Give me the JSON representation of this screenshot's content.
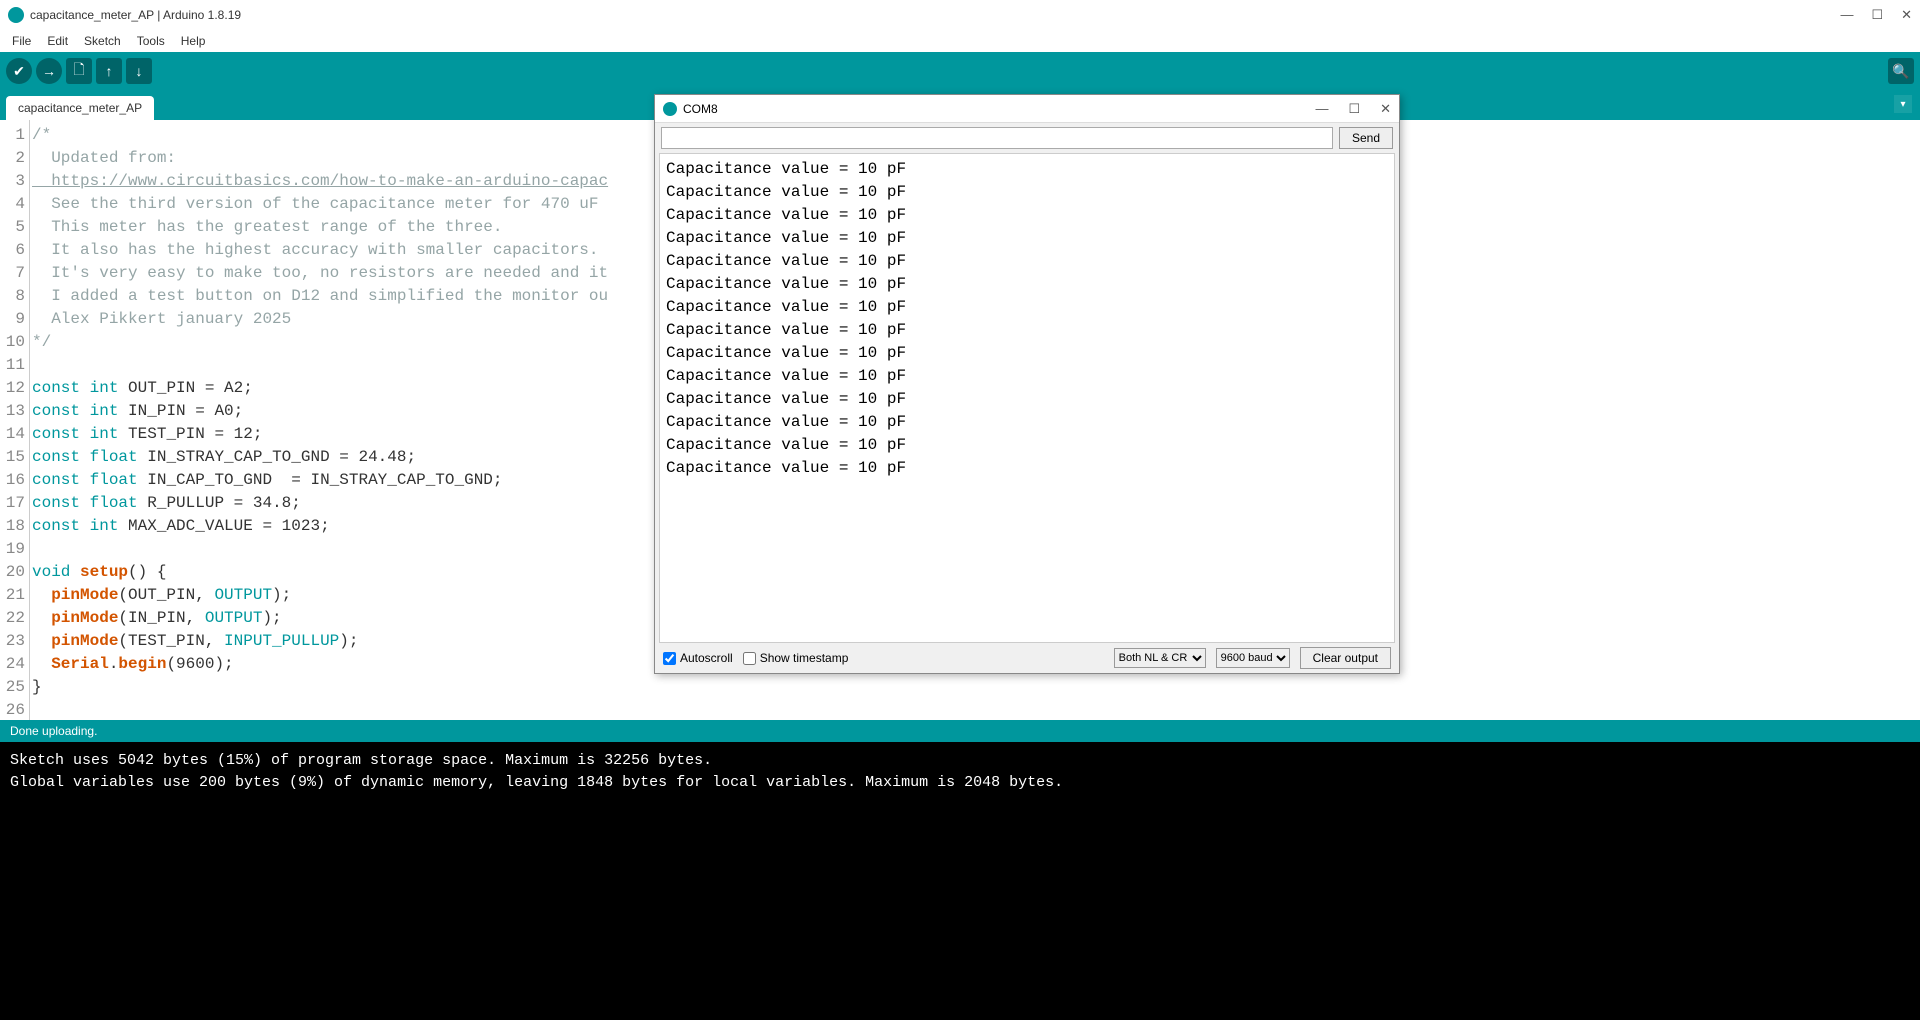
{
  "window": {
    "title": "capacitance_meter_AP | Arduino 1.8.19",
    "min": "—",
    "max": "☐",
    "close": "✕"
  },
  "menubar": [
    "File",
    "Edit",
    "Sketch",
    "Tools",
    "Help"
  ],
  "toolbar": {
    "verify": "✔",
    "upload": "→",
    "new": "🗋",
    "open": "↑",
    "save": "↓",
    "serial": "🔍"
  },
  "tab": {
    "name": "capacitance_meter_AP",
    "dropdown": "▾"
  },
  "code": {
    "lines": [
      {
        "n": 1,
        "html": "<span class='comment'>/*</span>"
      },
      {
        "n": 2,
        "html": "<span class='comment'>  Updated from:</span>"
      },
      {
        "n": 3,
        "html": "<span class='link'>  https://www.circuitbasics.com/how-to-make-an-arduino-capac</span>"
      },
      {
        "n": 4,
        "html": "<span class='comment'>  See the third version of the capacitance meter for 470 uF</span>"
      },
      {
        "n": 5,
        "html": "<span class='comment'>  This meter has the greatest range of the three.</span>"
      },
      {
        "n": 6,
        "html": "<span class='comment'>  It also has the highest accuracy with smaller capacitors.</span>"
      },
      {
        "n": 7,
        "html": "<span class='comment'>  It's very easy to make too, no resistors are needed and it</span>"
      },
      {
        "n": 8,
        "html": "<span class='comment'>  I added a test button on D12 and simplified the monitor ou</span>"
      },
      {
        "n": 9,
        "html": "<span class='comment'>  Alex Pikkert january 2025</span>"
      },
      {
        "n": 10,
        "html": "<span class='comment'>*/</span>"
      },
      {
        "n": 11,
        "html": ""
      },
      {
        "n": 12,
        "html": "<span class='kw'>const</span> <span class='kw'>int</span> OUT_PIN = A2;"
      },
      {
        "n": 13,
        "html": "<span class='kw'>const</span> <span class='kw'>int</span> IN_PIN = A0;"
      },
      {
        "n": 14,
        "html": "<span class='kw'>const</span> <span class='kw'>int</span> TEST_PIN = 12;"
      },
      {
        "n": 15,
        "html": "<span class='kw'>const</span> <span class='kw'>float</span> IN_STRAY_CAP_TO_GND = 24.48;"
      },
      {
        "n": 16,
        "html": "<span class='kw'>const</span> <span class='kw'>float</span> IN_CAP_TO_GND  = IN_STRAY_CAP_TO_GND;"
      },
      {
        "n": 17,
        "html": "<span class='kw'>const</span> <span class='kw'>float</span> R_PULLUP = 34.8;"
      },
      {
        "n": 18,
        "html": "<span class='kw'>const</span> <span class='kw'>int</span> MAX_ADC_VALUE = 1023;"
      },
      {
        "n": 19,
        "html": ""
      },
      {
        "n": 20,
        "html": "<span class='kw'>void</span> <span class='fn'>setup</span>() {"
      },
      {
        "n": 21,
        "html": "  <span class='fn'>pinMode</span>(OUT_PIN, <span class='const'>OUTPUT</span>);"
      },
      {
        "n": 22,
        "html": "  <span class='fn'>pinMode</span>(IN_PIN, <span class='const'>OUTPUT</span>);"
      },
      {
        "n": 23,
        "html": "  <span class='fn'>pinMode</span>(TEST_PIN, <span class='const'>INPUT_PULLUP</span>);"
      },
      {
        "n": 24,
        "html": "  <span class='fn'>Serial</span>.<span class='fn'>begin</span>(9600);"
      },
      {
        "n": 25,
        "html": "}"
      },
      {
        "n": 26,
        "html": ""
      }
    ]
  },
  "status": "Done uploading.",
  "console": "Sketch uses 5042 bytes (15%) of program storage space. Maximum is 32256 bytes.\nGlobal variables use 200 bytes (9%) of dynamic memory, leaving 1848 bytes for local variables. Maximum is 2048 bytes.",
  "serial": {
    "title": "COM8",
    "min": "—",
    "max": "☐",
    "close": "✕",
    "input_placeholder": "",
    "send": "Send",
    "output_lines": [
      "Capacitance value = 10 pF",
      "Capacitance value = 10 pF",
      "Capacitance value = 10 pF",
      "Capacitance value = 10 pF",
      "Capacitance value = 10 pF",
      "Capacitance value = 10 pF",
      "Capacitance value = 10 pF",
      "Capacitance value = 10 pF",
      "Capacitance value = 10 pF",
      "Capacitance value = 10 pF",
      "Capacitance value = 10 pF",
      "Capacitance value = 10 pF",
      "Capacitance value = 10 pF",
      "Capacitance value = 10 pF"
    ],
    "autoscroll": "Autoscroll",
    "autoscroll_checked": true,
    "timestamp": "Show timestamp",
    "timestamp_checked": false,
    "lineending": "Both NL & CR",
    "baud": "9600 baud",
    "clear": "Clear output"
  }
}
